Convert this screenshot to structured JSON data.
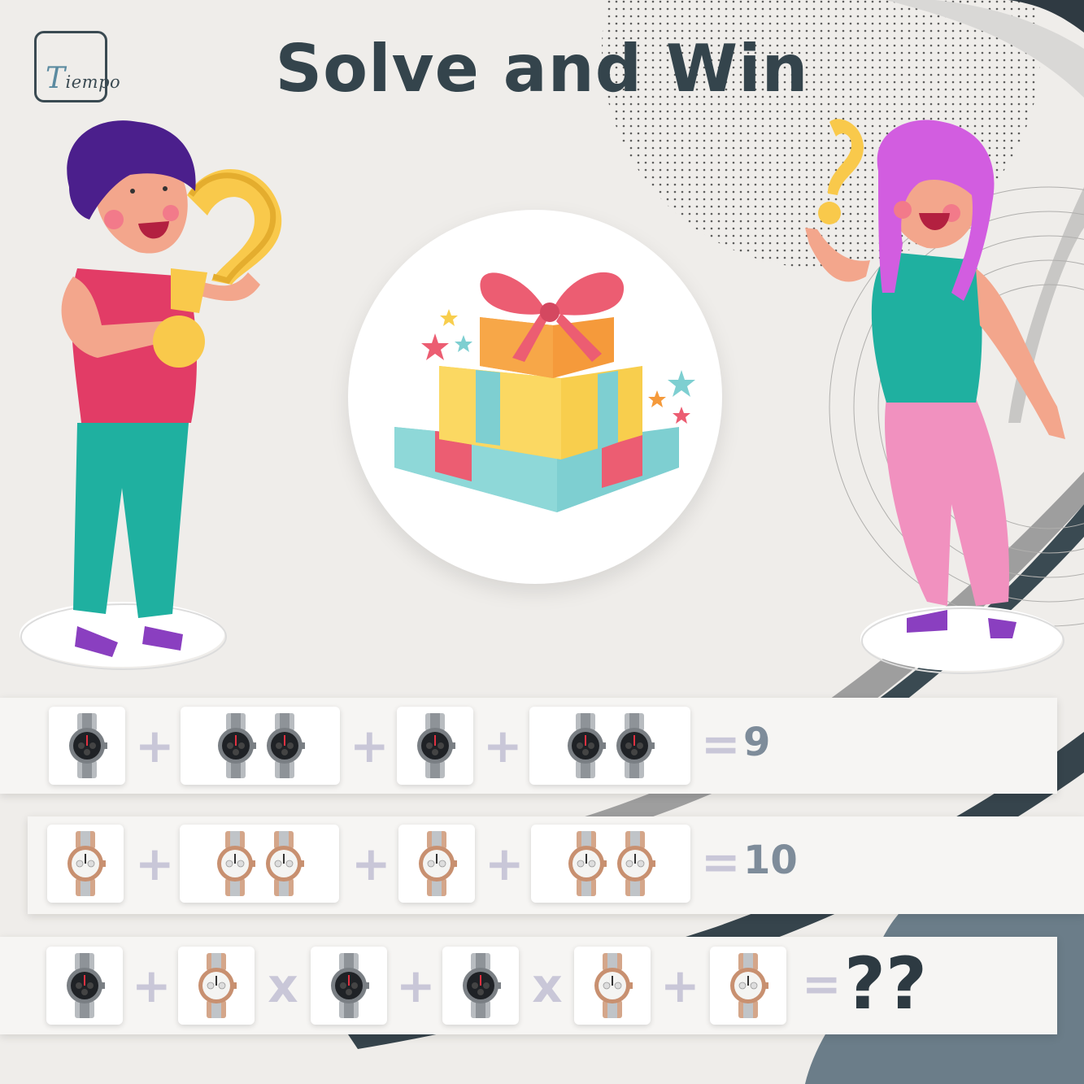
{
  "brand": {
    "logo_text": "Tiempo"
  },
  "title": "Solve and Win",
  "colors": {
    "background": "#efedea",
    "title": "#34444c",
    "operator": "#c9c7d8",
    "result": "#7e8c9a",
    "answer": "#2d3a42"
  },
  "icons": {
    "watch_black": "black-dial-chronograph-watch",
    "watch_rose": "rose-gold-silver-watch",
    "gift": "gift-boxes-icon"
  },
  "equations": [
    {
      "terms": [
        {
          "watch": "black",
          "count": 1
        },
        {
          "op": "+"
        },
        {
          "watch": "black",
          "count": 2
        },
        {
          "op": "+"
        },
        {
          "watch": "black",
          "count": 1
        },
        {
          "op": "+"
        },
        {
          "watch": "black",
          "count": 2
        }
      ],
      "equals": "=",
      "result": "9"
    },
    {
      "terms": [
        {
          "watch": "rose",
          "count": 1
        },
        {
          "op": "+"
        },
        {
          "watch": "rose",
          "count": 2
        },
        {
          "op": "+"
        },
        {
          "watch": "rose",
          "count": 1
        },
        {
          "op": "+"
        },
        {
          "watch": "rose",
          "count": 2
        }
      ],
      "equals": "=",
      "result": "10"
    },
    {
      "terms": [
        {
          "watch": "black",
          "count": 1
        },
        {
          "op": "+"
        },
        {
          "watch": "rose",
          "count": 1
        },
        {
          "op": "x"
        },
        {
          "watch": "black",
          "count": 1
        },
        {
          "op": "+"
        },
        {
          "watch": "black",
          "count": 1
        },
        {
          "op": "x"
        },
        {
          "watch": "rose",
          "count": 1
        },
        {
          "op": "+"
        },
        {
          "watch": "rose",
          "count": 1
        }
      ],
      "equals": "=",
      "result": "??"
    }
  ]
}
